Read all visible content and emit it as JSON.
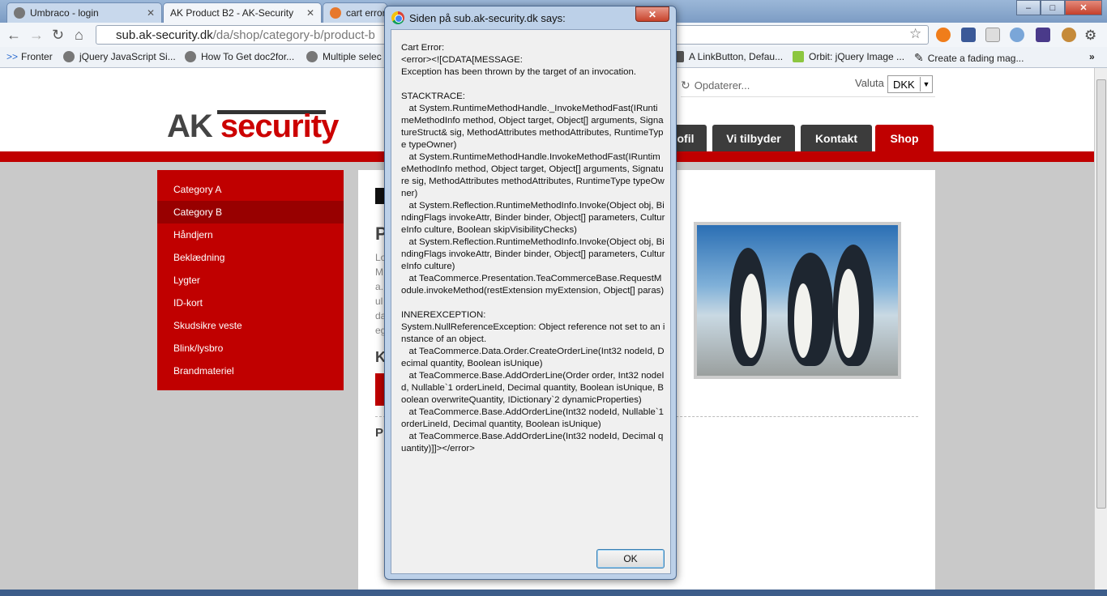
{
  "browser": {
    "tabs": [
      {
        "label": "Umbraco - login",
        "active": false
      },
      {
        "label": "AK  Product B2 - AK-Security",
        "active": true
      },
      {
        "label": "cart error",
        "active": false
      }
    ],
    "url_host": "sub.ak-security.dk",
    "url_path": "/da/shop/category-b/product-b",
    "bookmarks": [
      "Fronter",
      "jQuery JavaScript Si...",
      "How To Get doc2for...",
      "Multiple selec",
      "A LinkButton, Defau...",
      "Orbit: jQuery Image ...",
      "Create a fading mag..."
    ],
    "more_bookmarks": "»",
    "window_controls": {
      "minimize": "–",
      "maximize": "□",
      "close": "✕"
    }
  },
  "site": {
    "logo_ak": "AK",
    "logo_security": "security",
    "updating_label": "Opdaterer...",
    "currency_label": "Valuta",
    "currency_value": "DKK",
    "nav_tabs": [
      "ofil",
      "Vi tilbyder",
      "Kontakt",
      "Shop"
    ],
    "categories": [
      "Category A",
      "Category B",
      "Håndjern",
      "Beklædning",
      "Lygter",
      "ID-kort",
      "Skudsikre veste",
      "Blink/lysbro",
      "Brandmateriel"
    ],
    "content_heading": "P",
    "content_lines": [
      "Lo",
      "M",
      "a.",
      "ul",
      "da",
      "eg"
    ],
    "content_k": "K",
    "content_p": "P"
  },
  "dialog": {
    "title": "Siden på sub.ak-security.dk says:",
    "close": "✕",
    "message": "Cart Error:\n<error><![CDATA[MESSAGE:\nException has been thrown by the target of an invocation.\n\nSTACKTRACE:\n   at System.RuntimeMethodHandle._InvokeMethodFast(IRuntimeMethodInfo method, Object target, Object[] arguments, SignatureStruct& sig, MethodAttributes methodAttributes, RuntimeType typeOwner)\n   at System.RuntimeMethodHandle.InvokeMethodFast(IRuntimeMethodInfo method, Object target, Object[] arguments, Signature sig, MethodAttributes methodAttributes, RuntimeType typeOwner)\n   at System.Reflection.RuntimeMethodInfo.Invoke(Object obj, BindingFlags invokeAttr, Binder binder, Object[] parameters, CultureInfo culture, Boolean skipVisibilityChecks)\n   at System.Reflection.RuntimeMethodInfo.Invoke(Object obj, BindingFlags invokeAttr, Binder binder, Object[] parameters, CultureInfo culture)\n   at TeaCommerce.Presentation.TeaCommerceBase.RequestModule.invokeMethod(restExtension myExtension, Object[] paras)\n\nINNEREXCEPTION:\nSystem.NullReferenceException: Object reference not set to an instance of an object.\n   at TeaCommerce.Data.Order.CreateOrderLine(Int32 nodeId, Decimal quantity, Boolean isUnique)\n   at TeaCommerce.Base.AddOrderLine(Order order, Int32 nodeId, Nullable`1 orderLineId, Decimal quantity, Boolean isUnique, Boolean overwriteQuantity, IDictionary`2 dynamicProperties)\n   at TeaCommerce.Base.AddOrderLine(Int32 nodeId, Nullable`1 orderLineId, Decimal quantity, Boolean isUnique)\n   at TeaCommerce.Base.AddOrderLine(Int32 nodeId, Decimal quantity)]]></error>",
    "ok_label": "OK"
  },
  "colors": {
    "brand_red": "#c00000",
    "dark_tab": "#3c3c3c",
    "dialog_frame": "#bcd0e8"
  }
}
